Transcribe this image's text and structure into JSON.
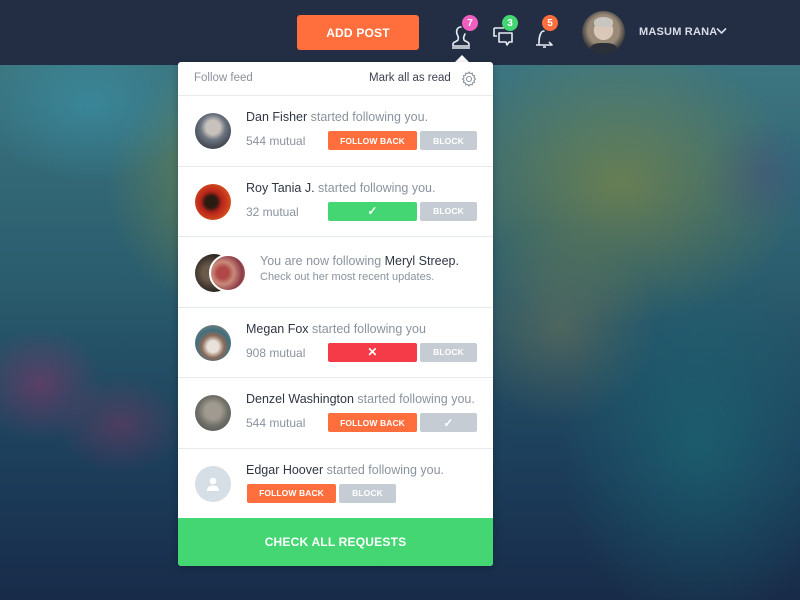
{
  "topbar": {
    "add_post_label": "ADD POST",
    "icons": [
      {
        "name": "follow-requests-icon",
        "badge": "7",
        "badge_color": "#f05fc0"
      },
      {
        "name": "messages-icon",
        "badge": "3",
        "badge_color": "#43d672"
      },
      {
        "name": "notifications-bell-icon",
        "badge": "5",
        "badge_color": "#ff6e3c"
      }
    ],
    "user_name": "MASUM RANA"
  },
  "panel": {
    "title": "Follow feed",
    "mark_all_read": "Mark all as read",
    "items": [
      {
        "name": "Dan Fisher",
        "action": " started following you.",
        "mutual": "544 mutual",
        "primary": "FOLLOW BACK",
        "primary_state": "follow",
        "secondary": "BLOCK"
      },
      {
        "name": "Roy Tania J.",
        "action": " started following you.",
        "mutual": "32 mutual",
        "primary": "✓",
        "primary_state": "accepted",
        "secondary": "BLOCK"
      },
      {
        "prefix": "You are now following ",
        "name": "Meryl Streep.",
        "subtext": "Check out her most recent updates."
      },
      {
        "name": "Megan Fox",
        "action": " started following you",
        "mutual": "908 mutual",
        "primary": "✕",
        "primary_state": "rejected",
        "secondary": "BLOCK"
      },
      {
        "name": "Denzel Washington",
        "action": " started following you.",
        "mutual": "544 mutual",
        "primary": "FOLLOW BACK",
        "primary_state": "follow",
        "secondary": "✓"
      },
      {
        "name": "Edgar Hoover",
        "action": " started following you.",
        "primary": "FOLLOW BACK",
        "primary_state": "follow",
        "secondary": "BLOCK"
      }
    ],
    "cta_label": "CHECK ALL REQUESTS"
  },
  "colors": {
    "topbar": "#232e44",
    "accent_orange": "#ff6e3c",
    "accent_green": "#43d672",
    "accent_red": "#f53b47",
    "muted_button": "#c6ccd3"
  }
}
